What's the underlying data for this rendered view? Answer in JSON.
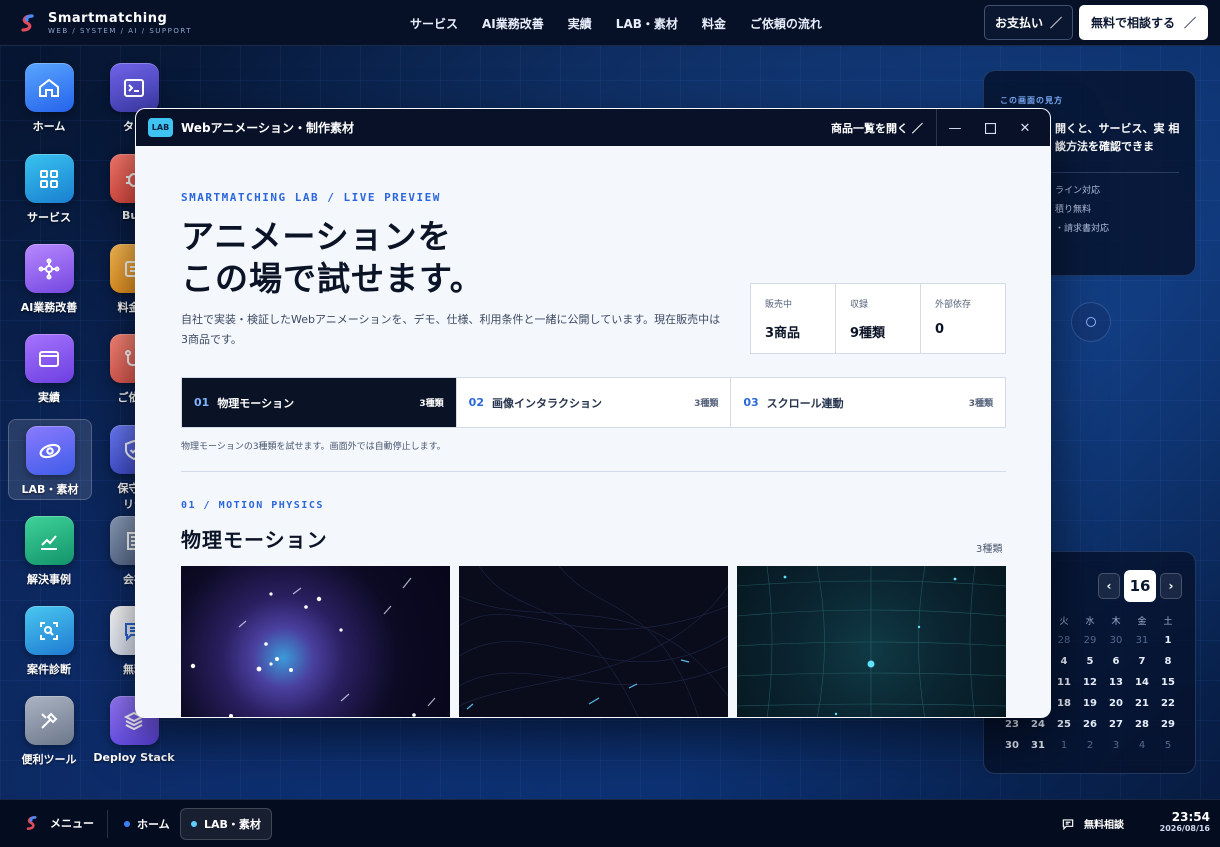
{
  "brand": {
    "name": "Smartmatching",
    "tagline": "WEB / SYSTEM / AI / SUPPORT"
  },
  "nav": [
    "サービス",
    "AI業務改善",
    "実績",
    "LAB・素材",
    "料金",
    "ご依頼の流れ"
  ],
  "header": {
    "pay_label": "お支払い",
    "consult_label": "無料で相談する"
  },
  "desktop": {
    "col1": [
      {
        "label": "ホーム",
        "icon": "home-icon"
      },
      {
        "label": "サービス",
        "icon": "grid-icon"
      },
      {
        "label": "AI業務改善",
        "icon": "ai-network-icon"
      },
      {
        "label": "実績",
        "icon": "browser-window-icon"
      },
      {
        "label": "LAB・素材",
        "icon": "eye-icon"
      },
      {
        "label": "解決事例",
        "icon": "chart-line-icon"
      },
      {
        "label": "案件診断",
        "icon": "scan-search-icon"
      },
      {
        "label": "便利ツール",
        "icon": "tools-icon"
      }
    ],
    "col2": [
      {
        "label": "ター",
        "icon": "terminal-icon"
      },
      {
        "label": "Bug",
        "icon": "bug-icon"
      },
      {
        "label": "料金・",
        "icon": "invoice-icon"
      },
      {
        "label": "ご依頼",
        "icon": "flow-icon"
      },
      {
        "label": "保守・",
        "label2": "リテ",
        "icon": "shield-check-icon"
      },
      {
        "label": "会社",
        "icon": "building-icon"
      },
      {
        "label": "無料",
        "icon": "chat-icon"
      },
      {
        "label": "Deploy Stack",
        "icon": "layers-icon"
      }
    ]
  },
  "info_panel": {
    "kicker": "この画面の見方",
    "text": "開くと、サービス、実 相談方法を確認できま",
    "rows": [
      "ライン対応",
      "積り無料",
      "・請求書対応"
    ]
  },
  "calendar": {
    "day": "16",
    "prev": "‹",
    "next": "›",
    "headers": [
      "",
      "",
      "火",
      "水",
      "木",
      "金",
      "土"
    ],
    "cells": [
      {
        "v": "",
        "d": false
      },
      {
        "v": "",
        "d": false
      },
      {
        "v": "28",
        "d": true
      },
      {
        "v": "29",
        "d": true
      },
      {
        "v": "30",
        "d": true
      },
      {
        "v": "31",
        "d": true
      },
      {
        "v": "1",
        "d": false
      },
      {
        "v": "",
        "d": false
      },
      {
        "v": "",
        "d": false
      },
      {
        "v": "4",
        "d": false
      },
      {
        "v": "5",
        "d": false
      },
      {
        "v": "6",
        "d": false
      },
      {
        "v": "7",
        "d": false
      },
      {
        "v": "8",
        "d": false
      },
      {
        "v": "",
        "d": false
      },
      {
        "v": "",
        "d": false
      },
      {
        "v": "11",
        "d": false
      },
      {
        "v": "12",
        "d": false
      },
      {
        "v": "13",
        "d": false
      },
      {
        "v": "14",
        "d": false
      },
      {
        "v": "15",
        "d": false
      },
      {
        "v": "",
        "d": false
      },
      {
        "v": "",
        "d": false
      },
      {
        "v": "18",
        "d": false
      },
      {
        "v": "19",
        "d": false
      },
      {
        "v": "20",
        "d": false
      },
      {
        "v": "21",
        "d": false
      },
      {
        "v": "22",
        "d": false
      },
      {
        "v": "23",
        "d": false
      },
      {
        "v": "24",
        "d": false
      },
      {
        "v": "25",
        "d": false
      },
      {
        "v": "26",
        "d": false
      },
      {
        "v": "27",
        "d": false
      },
      {
        "v": "28",
        "d": false
      },
      {
        "v": "29",
        "d": false
      },
      {
        "v": "30",
        "d": false
      },
      {
        "v": "31",
        "d": false
      },
      {
        "v": "1",
        "d": true
      },
      {
        "v": "2",
        "d": true
      },
      {
        "v": "3",
        "d": true
      },
      {
        "v": "4",
        "d": true
      },
      {
        "v": "5",
        "d": true
      }
    ]
  },
  "taskbar": {
    "menu": "メニュー",
    "home": "ホーム",
    "lab": "LAB・素材",
    "consult": "無料相談",
    "time": "23:54",
    "date": "2026/08/16"
  },
  "window": {
    "badge": "LAB",
    "title": "Webアニメーション・制作素材",
    "open_list": "商品一覧を開く",
    "kicker": "SMARTMATCHING LAB / LIVE PREVIEW",
    "headline_1": "アニメーションを",
    "headline_2": "この場で試せます。",
    "lead": "自社で実装・検証したWebアニメーションを、デモ、仕様、利用条件と一緒に公開しています。現在販売中は3商品です。",
    "stats": [
      {
        "label": "販売中",
        "value": "3商品"
      },
      {
        "label": "収録",
        "value": "9種類"
      },
      {
        "label": "外部依存",
        "value": "0"
      }
    ],
    "tabs": [
      {
        "num": "01",
        "label": "物理モーション",
        "count": "3種類"
      },
      {
        "num": "02",
        "label": "画像インタラクション",
        "count": "3種類"
      },
      {
        "num": "03",
        "label": "スクロール連動",
        "count": "3種類"
      }
    ],
    "tab_note": "物理モーションの3種類を試せます。画面外では自動停止します。",
    "section_kicker": "01 / MOTION PHYSICS",
    "section_title": "物理モーション",
    "section_count": "3種類"
  }
}
